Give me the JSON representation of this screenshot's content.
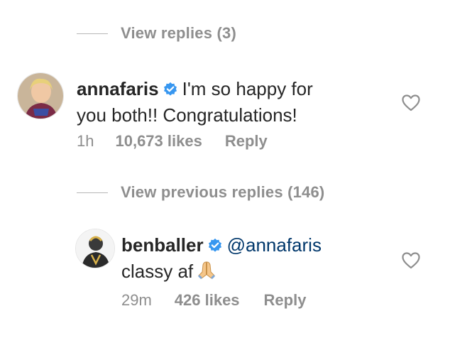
{
  "thread_top": {
    "toggle_label": "View replies (3)"
  },
  "comment1": {
    "username": "annafaris",
    "text_line1": "I'm so happy for",
    "text_line2": "you both!! Congratulations!",
    "time": "1h",
    "likes": "10,673 likes",
    "reply_label": "Reply"
  },
  "thread_mid": {
    "toggle_label": "View previous replies (146)"
  },
  "comment2": {
    "username": "benballer",
    "mention": "@annafaris",
    "text": "classy af",
    "emoji_icon": "folded-hands-emoji",
    "time": "29m",
    "likes": "426 likes",
    "reply_label": "Reply"
  },
  "colors": {
    "verified": "#3897f0",
    "secondary": "#8e8e8e",
    "mention": "#00376b"
  }
}
